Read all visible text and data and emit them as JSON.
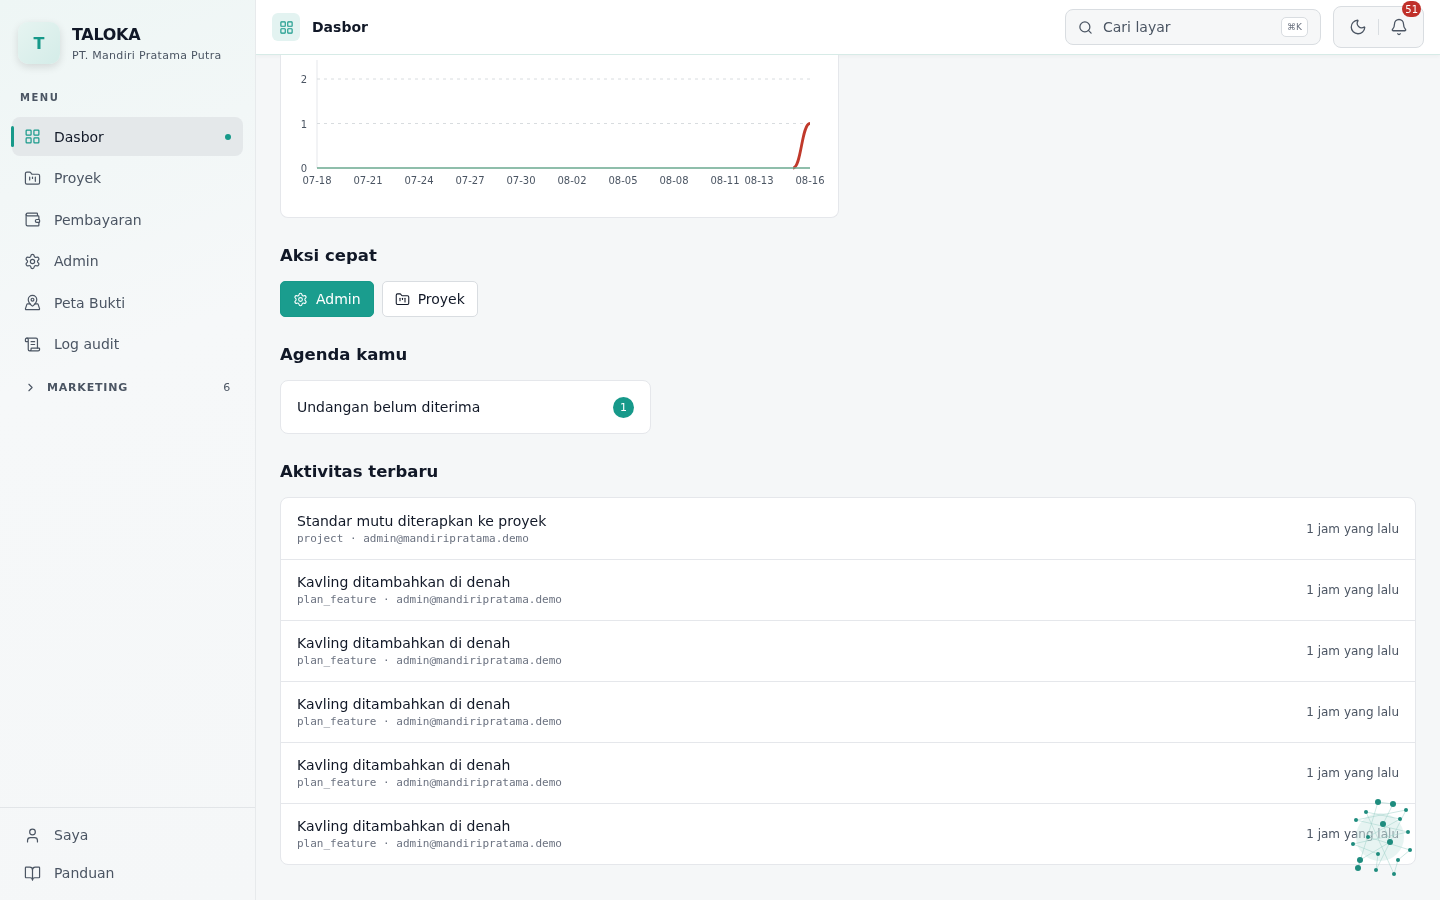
{
  "brand": {
    "logo_letter": "T",
    "name": "TALOKA",
    "company": "PT. Mandiri Pratama Putra"
  },
  "sidebar": {
    "section_label": "MENU",
    "items": [
      {
        "label": "Dasbor",
        "selected": true
      },
      {
        "label": "Proyek",
        "selected": false
      },
      {
        "label": "Pembayaran",
        "selected": false
      },
      {
        "label": "Admin",
        "selected": false
      },
      {
        "label": "Peta Bukti",
        "selected": false
      },
      {
        "label": "Log audit",
        "selected": false
      }
    ],
    "groups": [
      {
        "label": "MARKETING",
        "count": "6",
        "expanded": false
      }
    ],
    "footer_items": [
      {
        "label": "Saya"
      },
      {
        "label": "Panduan"
      }
    ]
  },
  "header": {
    "title": "Dasbor",
    "search": {
      "placeholder": "Cari layar",
      "shortcut": "⌘K"
    },
    "notification_count": "51"
  },
  "chart": {
    "chart_data": {
      "type": "line",
      "categories": [
        "07-18",
        null,
        null,
        "07-21",
        null,
        null,
        "07-24",
        null,
        null,
        "07-27",
        null,
        null,
        "07-30",
        null,
        null,
        "08-02",
        null,
        null,
        "08-05",
        null,
        null,
        "08-08",
        null,
        null,
        "08-11",
        null,
        "08-13",
        null,
        null,
        "08-16"
      ],
      "series": [
        {
          "color": "#6aa88f",
          "values": [
            0,
            0,
            0,
            0,
            0,
            0,
            0,
            0,
            0,
            0,
            0,
            0,
            0,
            0,
            0,
            0,
            0,
            0,
            0,
            0,
            0,
            0,
            0,
            0,
            0,
            0,
            0,
            0,
            0,
            0
          ]
        },
        {
          "color": "#c0392b",
          "values": [
            null,
            null,
            null,
            null,
            null,
            null,
            null,
            null,
            null,
            null,
            null,
            null,
            null,
            null,
            null,
            null,
            null,
            null,
            null,
            null,
            null,
            null,
            null,
            null,
            null,
            null,
            null,
            null,
            0,
            1
          ]
        }
      ],
      "ylim": [
        0,
        2
      ],
      "yticks": [
        0,
        1,
        2
      ]
    }
  },
  "quick_actions": {
    "title": "Aksi cepat",
    "buttons": [
      {
        "label": "Admin",
        "kind": "primary"
      },
      {
        "label": "Proyek",
        "kind": "secondary"
      }
    ]
  },
  "agenda": {
    "title": "Agenda kamu",
    "items": [
      {
        "label": "Undangan belum diterima",
        "count": "1"
      }
    ]
  },
  "activity": {
    "title": "Aktivitas terbaru",
    "items": [
      {
        "title": "Standar mutu diterapkan ke proyek",
        "meta": "project · admin@mandiripratama.demo",
        "time": "1 jam yang lalu"
      },
      {
        "title": "Kavling ditambahkan di denah",
        "meta": "plan_feature · admin@mandiripratama.demo",
        "time": "1 jam yang lalu"
      },
      {
        "title": "Kavling ditambahkan di denah",
        "meta": "plan_feature · admin@mandiripratama.demo",
        "time": "1 jam yang lalu"
      },
      {
        "title": "Kavling ditambahkan di denah",
        "meta": "plan_feature · admin@mandiripratama.demo",
        "time": "1 jam yang lalu"
      },
      {
        "title": "Kavling ditambahkan di denah",
        "meta": "plan_feature · admin@mandiripratama.demo",
        "time": "1 jam yang lalu"
      },
      {
        "title": "Kavling ditambahkan di denah",
        "meta": "plan_feature · admin@mandiripratama.demo",
        "time": "1 jam yang lalu"
      }
    ]
  }
}
